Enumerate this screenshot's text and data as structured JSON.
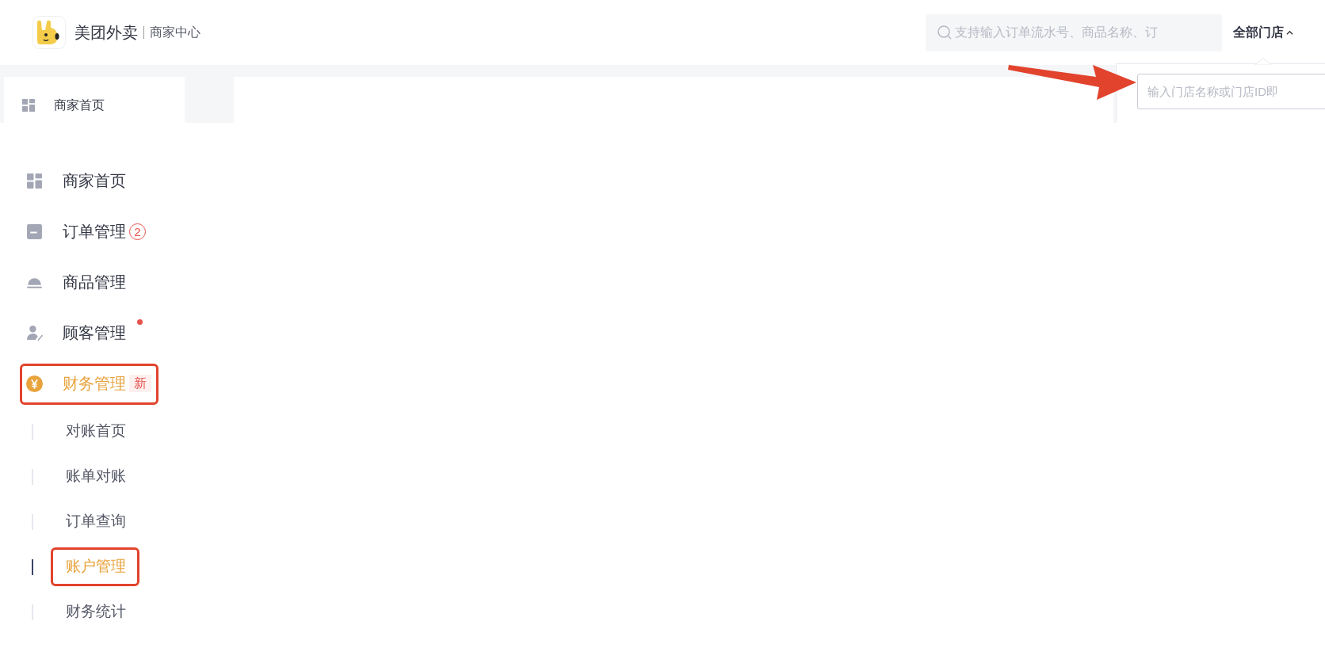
{
  "header": {
    "brand": "美团外卖",
    "subtitle": "商家中心",
    "search": {
      "placeholder": "支持输入订单流水号、商品名称、订"
    },
    "store_selector": {
      "label": "全部门店",
      "expanded": true
    }
  },
  "store_dropdown": {
    "placeholder": "输入门店名称或门店ID即",
    "pointed_by_arrow": true
  },
  "preview_sidebar": {
    "items": [
      {
        "label": "商家首页",
        "kind": "grid"
      }
    ]
  },
  "sidebar": {
    "items": [
      {
        "label": "商家首页",
        "kind": "grid",
        "active": false,
        "highlighted": false
      },
      {
        "label": "订单管理",
        "kind": "order",
        "active": false,
        "highlighted": false,
        "count": "2"
      },
      {
        "label": "商品管理",
        "kind": "cloche",
        "active": false,
        "highlighted": false
      },
      {
        "label": "顾客管理",
        "kind": "person",
        "active": false,
        "highlighted": false,
        "dot": true
      },
      {
        "label": "财务管理",
        "kind": "yuan",
        "active": true,
        "highlighted": true,
        "tag": "新",
        "expanded": true,
        "children": [
          {
            "label": "对账首页",
            "selected": false,
            "highlighted": false
          },
          {
            "label": "账单对账",
            "selected": false,
            "highlighted": false
          },
          {
            "label": "订单查询",
            "selected": false,
            "highlighted": false
          },
          {
            "label": "账户管理",
            "selected": true,
            "highlighted": true
          },
          {
            "label": "财务统计",
            "selected": false,
            "highlighted": false
          }
        ]
      }
    ]
  }
}
